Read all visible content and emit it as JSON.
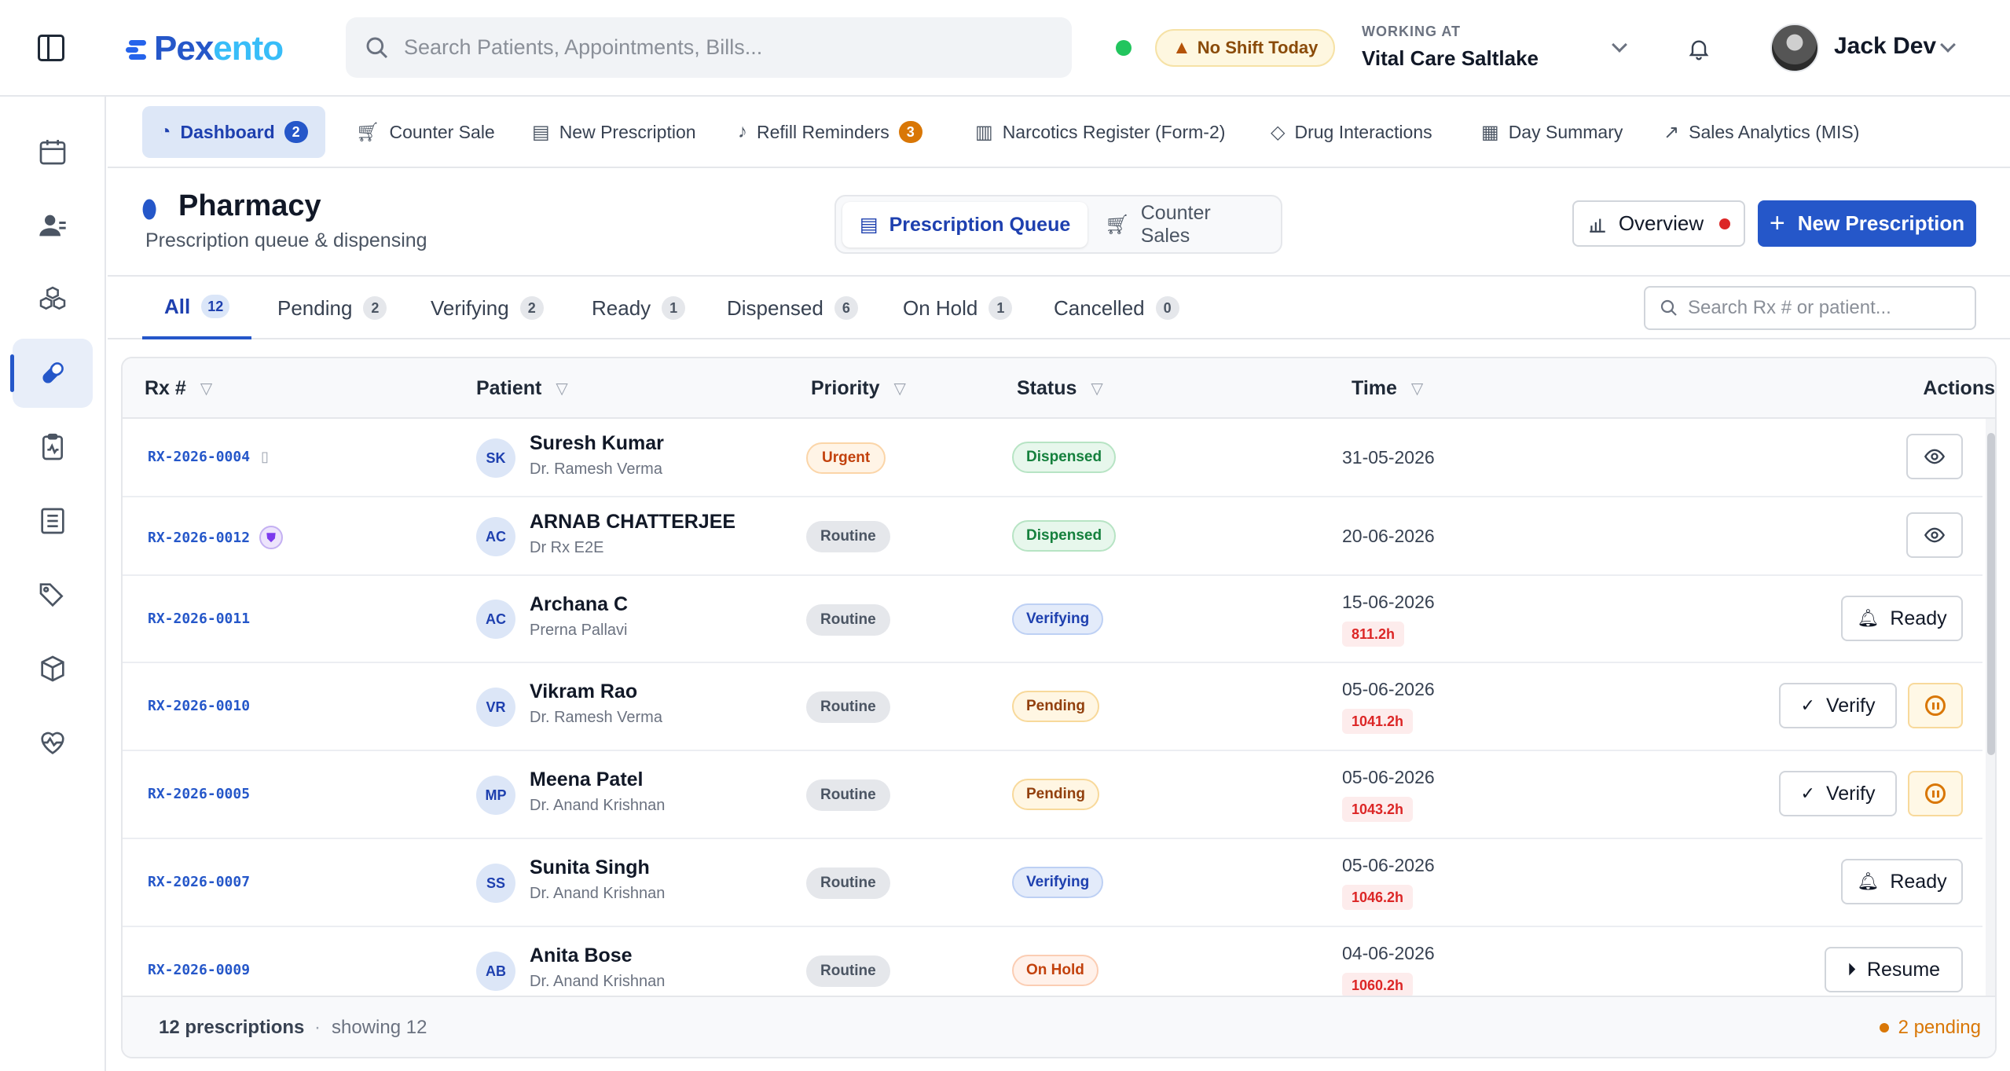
{
  "app": {
    "logo_main": "Pex",
    "logo_accent": "ento",
    "search_placeholder": "Search Patients, Appointments, Bills...",
    "shift_badge": "No Shift Today",
    "working_label": "WORKING AT",
    "working_value": "Vital Care Saltlake",
    "user_name": "Jack Dev"
  },
  "nav": {
    "items": [
      {
        "label": "Dashboard",
        "icon": "gauge-icon",
        "count": "2"
      },
      {
        "label": "Counter Sale",
        "icon": "cart-icon"
      },
      {
        "label": "New Prescription",
        "icon": "rx-doc-icon"
      },
      {
        "label": "Refill Reminders",
        "icon": "bell-icon",
        "count": "3"
      },
      {
        "label": "Narcotics Register (Form-2)",
        "icon": "register-icon"
      },
      {
        "label": "Drug Interactions",
        "icon": "diamond-icon"
      },
      {
        "label": "Day Summary",
        "icon": "clipboard-icon"
      },
      {
        "label": "Sales Analytics (MIS)",
        "icon": "trend-icon"
      }
    ]
  },
  "page": {
    "title": "Pharmacy",
    "subtitle": "Prescription queue & dispensing",
    "seg_queue": "Prescription Queue",
    "seg_counter": "Counter Sales",
    "overview_label": "Overview",
    "new_prescription_label": "New Prescription"
  },
  "status_tabs": [
    {
      "label": "All",
      "count": "12"
    },
    {
      "label": "Pending",
      "count": "2"
    },
    {
      "label": "Verifying",
      "count": "2"
    },
    {
      "label": "Ready",
      "count": "1"
    },
    {
      "label": "Dispensed",
      "count": "6"
    },
    {
      "label": "On Hold",
      "count": "1"
    },
    {
      "label": "Cancelled",
      "count": "0"
    }
  ],
  "rx_search_placeholder": "Search Rx # or patient...",
  "table": {
    "headers": {
      "rx": "Rx #",
      "patient": "Patient",
      "priority": "Priority",
      "status": "Status",
      "time": "Time",
      "actions": "Actions"
    },
    "rows": [
      {
        "rx": "RX-2026-0004",
        "badge": "document",
        "initials": "SK",
        "name": "Suresh Kumar",
        "doctor": "Dr. Ramesh Verma",
        "priority": "Urgent",
        "status": "Dispensed",
        "date": "31-05-2026",
        "elapsed": "",
        "action": "view"
      },
      {
        "rx": "RX-2026-0012",
        "badge": "shield",
        "initials": "AC",
        "name": "ARNAB CHATTERJEE",
        "doctor": "Dr Rx E2E",
        "priority": "Routine",
        "status": "Dispensed",
        "date": "20-06-2026",
        "elapsed": "",
        "action": "view"
      },
      {
        "rx": "RX-2026-0011",
        "badge": "",
        "initials": "AC",
        "name": "Archana C",
        "doctor": "Prerna Pallavi",
        "priority": "Routine",
        "status": "Verifying",
        "date": "15-06-2026",
        "elapsed": "811.2h",
        "action": "Ready"
      },
      {
        "rx": "RX-2026-0010",
        "badge": "",
        "initials": "VR",
        "name": "Vikram Rao",
        "doctor": "Dr. Ramesh Verma",
        "priority": "Routine",
        "status": "Pending",
        "date": "05-06-2026",
        "elapsed": "1041.2h",
        "action": "Verify"
      },
      {
        "rx": "RX-2026-0005",
        "badge": "",
        "initials": "MP",
        "name": "Meena Patel",
        "doctor": "Dr. Anand Krishnan",
        "priority": "Routine",
        "status": "Pending",
        "date": "05-06-2026",
        "elapsed": "1043.2h",
        "action": "Verify"
      },
      {
        "rx": "RX-2026-0007",
        "badge": "",
        "initials": "SS",
        "name": "Sunita Singh",
        "doctor": "Dr. Anand Krishnan",
        "priority": "Routine",
        "status": "Verifying",
        "date": "05-06-2026",
        "elapsed": "1046.2h",
        "action": "Ready"
      },
      {
        "rx": "RX-2026-0009",
        "badge": "",
        "initials": "AB",
        "name": "Anita Bose",
        "doctor": "Dr. Anand Krishnan",
        "priority": "Routine",
        "status": "On Hold",
        "date": "04-06-2026",
        "elapsed": "1060.2h",
        "action": "Resume"
      }
    ]
  },
  "footer": {
    "count": "12 prescriptions",
    "separator": "·",
    "showing": "showing 12",
    "pending": "2 pending"
  },
  "colors": {
    "brand": "#2557c9",
    "pending": "#d97706",
    "danger": "#dc2626",
    "success": "#15803d"
  }
}
